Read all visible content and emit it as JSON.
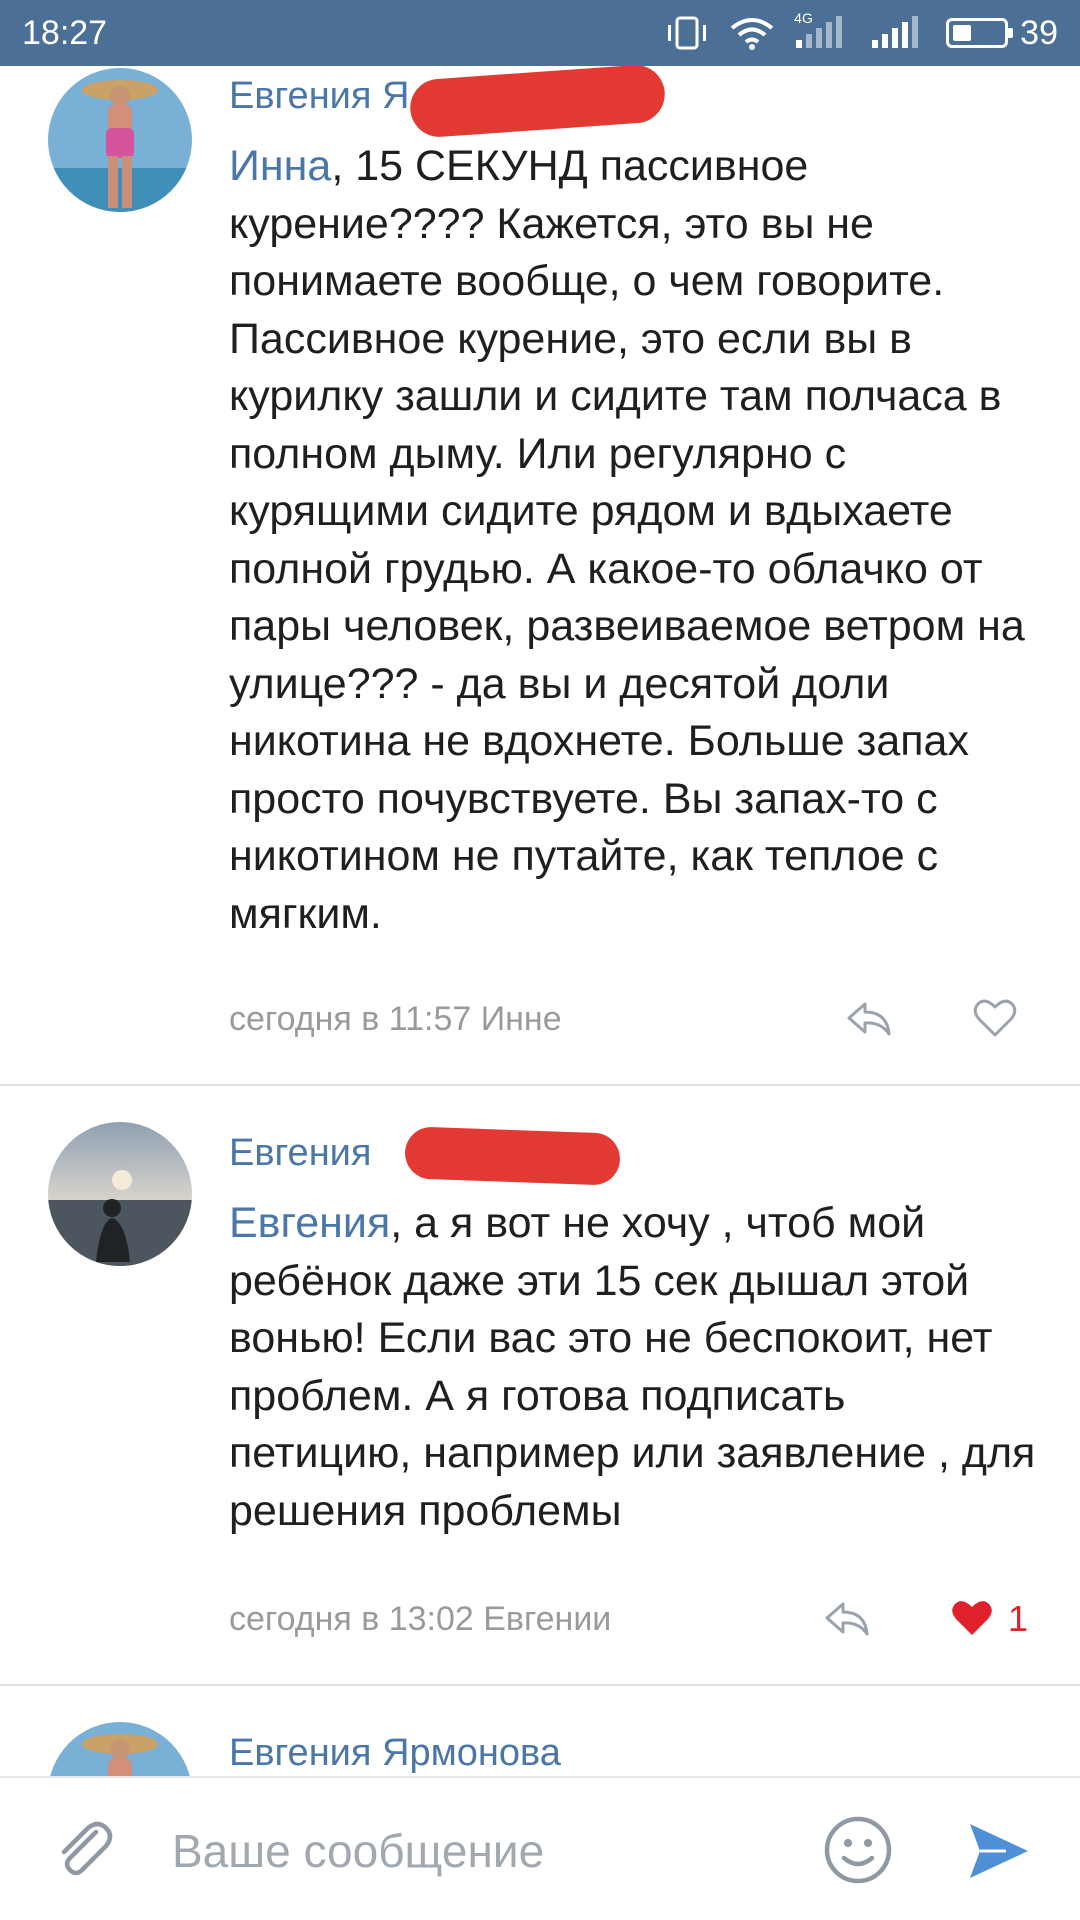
{
  "status_bar": {
    "time": "18:27",
    "network_label": "4G",
    "battery_level": "39",
    "icons": [
      "vibrate-icon",
      "wifi-icon",
      "signal-4g-icon",
      "signal-icon",
      "battery-icon"
    ]
  },
  "comments": [
    {
      "author": "Евгения Я",
      "mention": "Инна",
      "text": ", 15 СЕКУНД пассивное курение???? Кажется, это вы не понимаете вообще, о чем говорите. Пассивное курение, это если вы в курилку зашли и сидите там полчаса в полном дыму. Или регулярно с курящими сидите рядом и вдыхаете полной грудью. А какое-то облачко от пары человек, развеиваемое ветром на улице??? - да вы и десятой доли никотина не вдохнете. Больше запах просто почувствуете. Вы запах-то с никотином не путайте, как теплое с мягким.",
      "meta": "сегодня в 11:57 Инне",
      "liked": false,
      "like_count": ""
    },
    {
      "author": "Евгения",
      "mention": "Евгения",
      "text": ", а я вот не хочу , чтоб мой ребёнок даже эти 15 сек дышал этой вонью! Если вас это не беспокоит, нет проблем. А я готова подписать петицию, например или заявление , для решения проблемы",
      "meta": "сегодня в 13:02 Евгении",
      "liked": true,
      "like_count": "1"
    },
    {
      "author": "Евгения Ярмонова"
    }
  ],
  "input_bar": {
    "placeholder": "Ваше сообщение",
    "icons": [
      "paperclip-icon",
      "emoji-icon",
      "send-icon"
    ]
  },
  "colors": {
    "status_bar_bg": "#4c6f95",
    "link_blue": "#4a76a8",
    "redaction_red": "#e23a33",
    "like_red": "#e0202a",
    "meta_gray": "#9a9a9a"
  }
}
